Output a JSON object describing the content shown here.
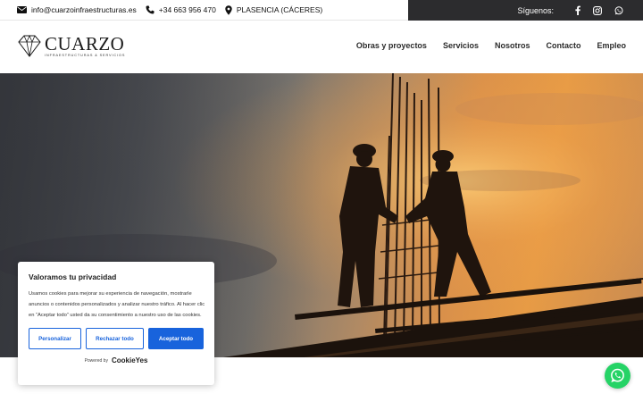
{
  "topbar": {
    "email": "info@cuarzoinfraestructuras.es",
    "phone": "+34 663 956 470",
    "location": "PLASENCIA (CÁCERES)",
    "follow_label": "Síguenos:",
    "social_icons": [
      "facebook-icon",
      "instagram-icon",
      "whatsapp-icon"
    ]
  },
  "header": {
    "logo_name": "CUARZO",
    "logo_tagline": "INFRAESTRUCTURAS & SERVICIOS",
    "nav": [
      "Obras y proyectos",
      "Servicios",
      "Nosotros",
      "Contacto",
      "Empleo"
    ]
  },
  "cookie_banner": {
    "title": "Valoramos tu privacidad",
    "text": "Usamos cookies para mejorar su experiencia de navegación, mostrarle anuncios o contenidos personalizados y analizar nuestro tráfico. Al hacer clic en “Aceptar todo” usted da su consentimiento a nuestro uso de las cookies.",
    "buttons": {
      "customize": "Personalizar",
      "reject": "Rechazar todo",
      "accept": "Aceptar todo"
    },
    "powered_by": "Powered by",
    "powered_brand": "CookieYes"
  },
  "colors": {
    "topbar_dark": "#2c2c2e",
    "accent_blue": "#1863dc",
    "whatsapp_green": "#25d366",
    "nav_text": "#2b2b2b"
  }
}
